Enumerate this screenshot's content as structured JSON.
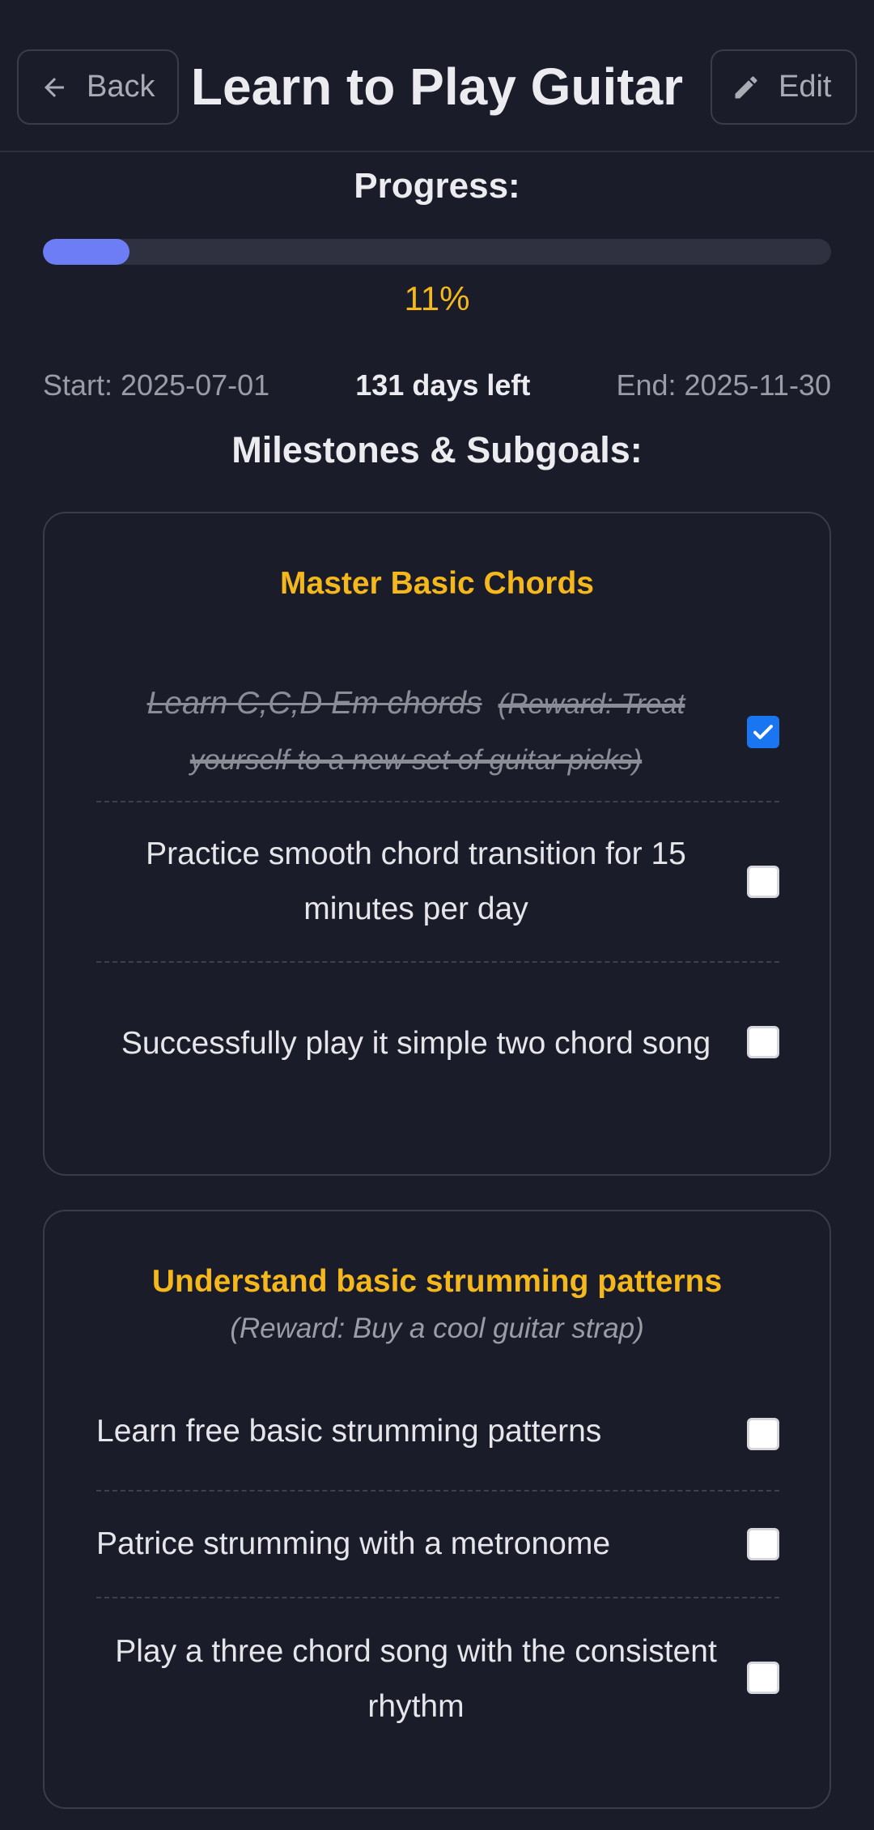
{
  "header": {
    "back_label": "Back",
    "title": "Learn to Play Guitar",
    "edit_label": "Edit",
    "back_icon": "arrow-left-icon",
    "edit_icon": "pencil-icon"
  },
  "progress": {
    "label": "Progress:",
    "value_fraction": 0.11,
    "percent_text": "11%"
  },
  "dates": {
    "start": "Start: 2025-07-01",
    "days_left": "131 days left",
    "end": "End: 2025-11-30"
  },
  "section_title": "Milestones & Subgoals:",
  "milestones": [
    {
      "title": "Master Basic Chords",
      "reward": "",
      "tasks": [
        {
          "text": "Learn C,C,D Em chords",
          "reward": "(Reward: Treat yourself to a new set of guitar picks)",
          "done": true
        },
        {
          "text": "Practice smooth chord transition for 15 minutes per day",
          "reward": "",
          "done": false
        },
        {
          "text": "Successfully play it simple two chord song",
          "reward": "",
          "done": false
        }
      ]
    },
    {
      "title": "Understand basic strumming patterns",
      "reward": "(Reward: Buy a cool guitar strap)",
      "tasks": [
        {
          "text": "Learn free basic strumming patterns",
          "reward": "",
          "done": false
        },
        {
          "text": "Patrice strumming with a metronome",
          "reward": "",
          "done": false
        },
        {
          "text": "Play a three chord song with the consistent rhythm",
          "reward": "",
          "done": false
        }
      ]
    }
  ],
  "colors": {
    "background": "#1b1c29",
    "accent": "#f5b81c",
    "progress_fill": "#6d7df5",
    "checkbox_checked": "#1976f0"
  }
}
